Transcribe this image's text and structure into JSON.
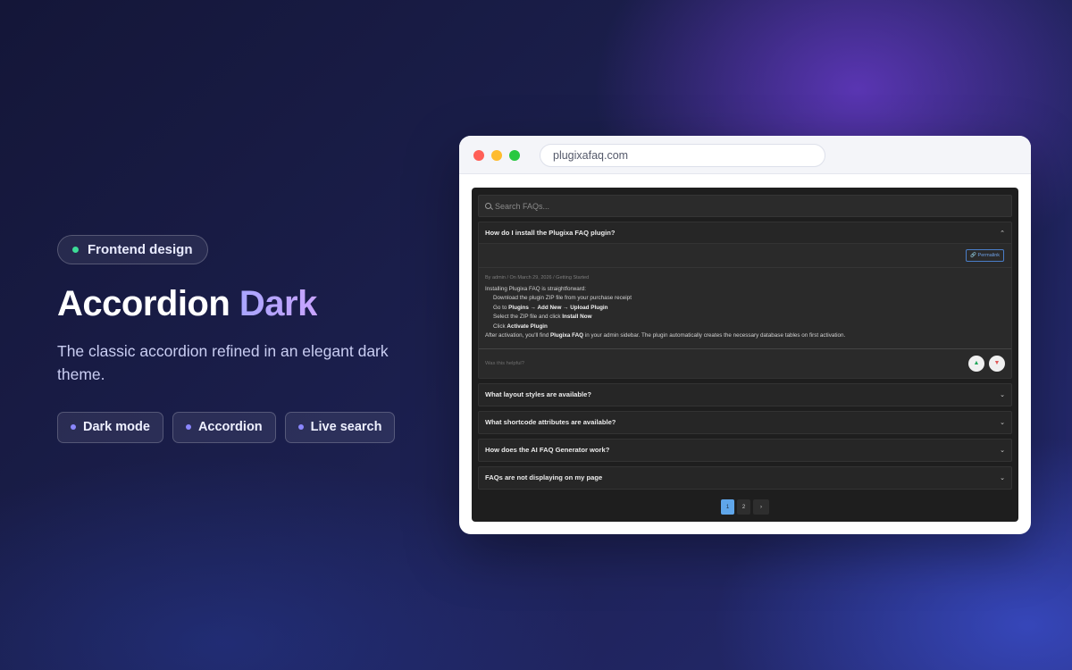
{
  "hero": {
    "badge": "Frontend design",
    "title_main": "Accordion",
    "title_accent": "Dark",
    "subtitle": "The classic accordion refined in an elegant dark theme.",
    "tags": [
      "Dark mode",
      "Accordion",
      "Live search"
    ],
    "colors": {
      "badge_dot": "#3ddc97",
      "tag_dot": "#8b87ff",
      "accent": "#a8a5ff"
    }
  },
  "browser": {
    "url": "plugixafaq.com"
  },
  "faq": {
    "search_placeholder": "Search FAQs...",
    "open_item": {
      "question": "How do I install the Plugixa FAQ plugin?",
      "permalink": "🔗 Permalink",
      "meta": "By admin / On March 29, 2026 / Getting Started",
      "intro": "Installing Plugixa FAQ is straightforward:",
      "step1": "Download the plugin ZIP file from your purchase receipt",
      "step2_prefix": "Go to ",
      "step2_b1": "Plugins → Add New → Upload Plugin",
      "step3_prefix": "Select the ZIP file and click ",
      "step3_b": "Install Now",
      "step4_prefix": "Click ",
      "step4_b": "Activate Plugin",
      "outro_prefix": "After activation, you'll find ",
      "outro_b": "Plugixa FAQ",
      "outro_suffix": " in your admin sidebar. The plugin automatically creates the necessary database tables on first activation.",
      "helpful": "Was this helpful?"
    },
    "items": [
      "What layout styles are available?",
      "What shortcode attributes are available?",
      "How does the AI FAQ Generator work?",
      "FAQs are not displaying on my page"
    ],
    "pagination": {
      "pages": [
        "1",
        "2"
      ],
      "current": "1",
      "next": "›"
    }
  }
}
